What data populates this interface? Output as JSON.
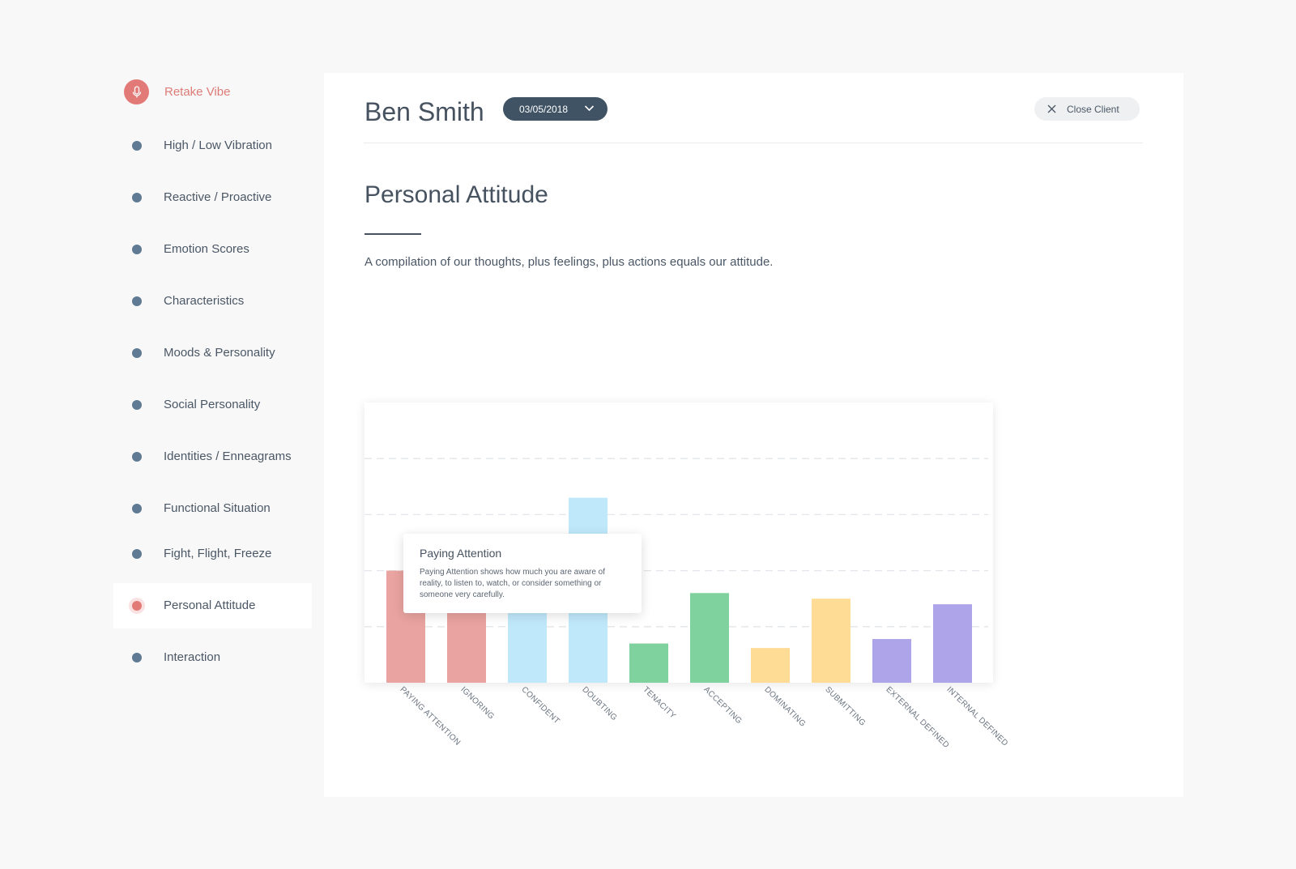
{
  "sidebar": {
    "retake_label": "Retake Vibe",
    "items": [
      {
        "label": "High / Low Vibration"
      },
      {
        "label": "Reactive / Proactive"
      },
      {
        "label": "Emotion Scores"
      },
      {
        "label": "Characteristics"
      },
      {
        "label": "Moods & Personality"
      },
      {
        "label": "Social Personality"
      },
      {
        "label": "Identities / Enneagrams"
      },
      {
        "label": "Functional Situation"
      },
      {
        "label": "Fight, Flight, Freeze"
      },
      {
        "label": "Personal Attitude"
      },
      {
        "label": "Interaction"
      }
    ],
    "active_index": 9
  },
  "header": {
    "client_name": "Ben Smith",
    "date": "03/05/2018",
    "close_label": "Close Client"
  },
  "section": {
    "title": "Personal Attitude",
    "description": "A compilation of our thoughts, plus feelings, plus actions equals our attitude."
  },
  "tooltip": {
    "title": "Paying Attention",
    "body": "Paying Attention shows how much you are aware of reality, to listen to, watch, or consider something or someone very carefully."
  },
  "colors": {
    "accent": "#e27b77",
    "nav_dot": "#5f7a92",
    "date_pill": "#3f5365"
  },
  "icons": {
    "retake": "microphone-icon",
    "date": "chevron-down-icon",
    "close": "close-icon"
  },
  "chart_data": {
    "type": "bar",
    "categories": [
      "PAYING ATTENTION",
      "IGNORING",
      "CONFIDENT",
      "DOUBTING",
      "TENACITY",
      "ACCEPTING",
      "DOMINATING",
      "SUBMITTING",
      "EXTERNAL DEFINED",
      "INTERNAL DEFINED"
    ],
    "values": [
      2.0,
      1.3,
      2.5,
      3.3,
      0.7,
      1.6,
      0.62,
      1.5,
      0.78,
      1.4
    ],
    "colors": [
      "#e9a3a0",
      "#e9a3a0",
      "#bfe9fa",
      "#bfe9fa",
      "#7fd19d",
      "#7fd19d",
      "#fedc95",
      "#fedc95",
      "#aea4ea",
      "#aea4ea"
    ],
    "ylim": [
      0,
      5
    ],
    "grid": true,
    "grid_style": "dashed"
  }
}
